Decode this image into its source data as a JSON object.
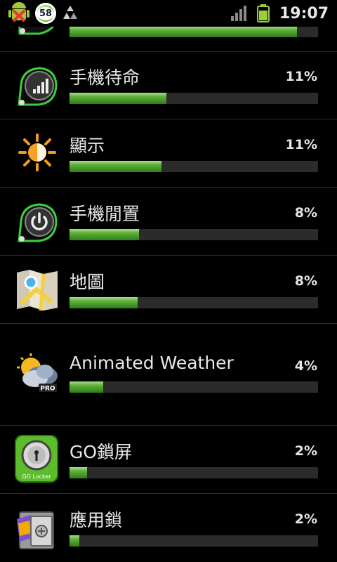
{
  "status_bar": {
    "notification_count": "58",
    "time": "19:07",
    "icons": [
      "android-debug-icon",
      "notification-badge-icon",
      "recycle-icon",
      "signal-icon",
      "battery-icon"
    ]
  },
  "accent_color": "#4caf50",
  "items": [
    {
      "name": "",
      "percent": "",
      "fraction": 0.915,
      "icon": "app-icon-partial"
    },
    {
      "name": "手機待命",
      "percent": "11%",
      "fraction": 0.39,
      "icon": "cell-standby-icon"
    },
    {
      "name": "顯示",
      "percent": "11%",
      "fraction": 0.37,
      "icon": "display-brightness-icon"
    },
    {
      "name": "手機閒置",
      "percent": "8%",
      "fraction": 0.28,
      "icon": "phone-idle-power-icon"
    },
    {
      "name": "地圖",
      "percent": "8%",
      "fraction": 0.275,
      "icon": "maps-icon"
    },
    {
      "name": "Animated Weather",
      "percent": "4%",
      "fraction": 0.135,
      "icon": "animated-weather-pro-icon",
      "icon_badge": "PRO"
    },
    {
      "name": "GO鎖屏",
      "percent": "2%",
      "fraction": 0.07,
      "icon": "go-locker-icon",
      "icon_label": "GO Locker"
    },
    {
      "name": "應用鎖",
      "percent": "2%",
      "fraction": 0.04,
      "icon": "app-lock-safe-icon"
    }
  ]
}
